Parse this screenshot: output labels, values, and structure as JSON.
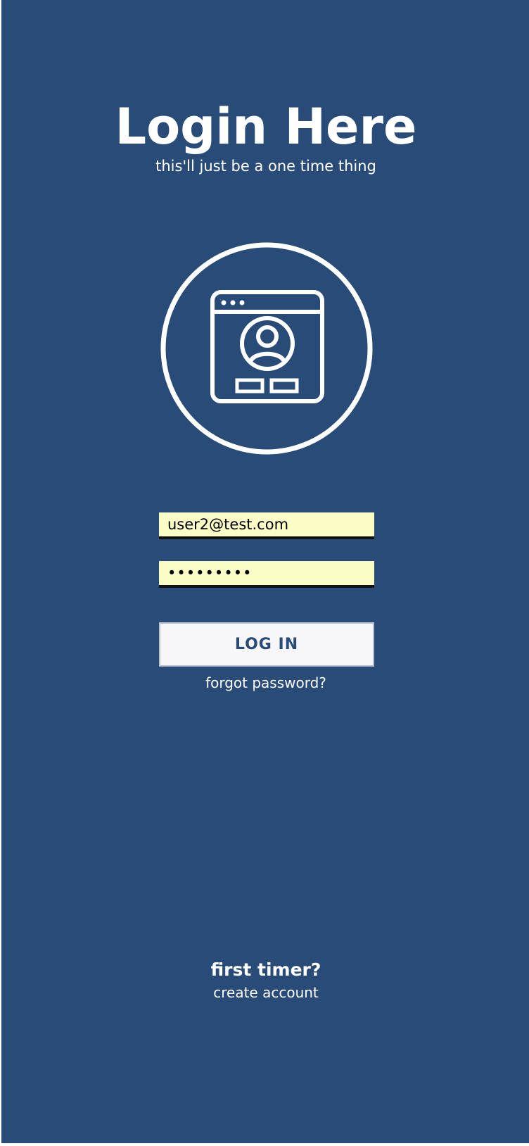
{
  "header": {
    "title": "Login Here",
    "subtitle": "this'll just be a one time thing"
  },
  "emblem": {
    "icon": "user-login-window-icon"
  },
  "form": {
    "email_value": "user2@test.com",
    "password_value": "•••••••••",
    "login_label": "LOG IN",
    "forgot_label": "forgot password?"
  },
  "footer": {
    "first_timer_label": "first timer?",
    "create_account_label": "create account"
  },
  "colors": {
    "background": "#284b78",
    "field_bg": "#fbfdc7",
    "button_bg": "#f7f7f9",
    "text": "#ffffff"
  }
}
